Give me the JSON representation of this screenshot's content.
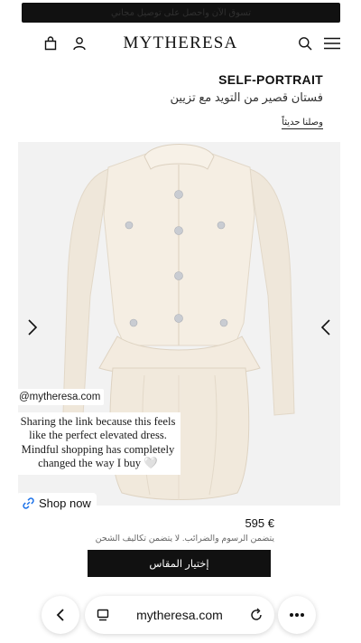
{
  "promo": {
    "text": "تسوق الآن واحصل على توصيل مجاني"
  },
  "header": {
    "logo": "MYTHERESA",
    "icons": [
      "bag-icon",
      "user-icon",
      "search-icon",
      "menu-icon"
    ]
  },
  "product": {
    "brand": "SELF-PORTRAIT",
    "name": "فستان قصير من التويد مع تزيين",
    "badge": "وصلنا حديثاً",
    "price": "595 €",
    "tax_note": "يتضمن الرسوم والضرائب. لا يتضمن تكاليف الشحن",
    "select_size_label": "إختيار المقاس"
  },
  "story": {
    "mention": "@mytheresa.com",
    "caption": "Sharing the link because this feels like the perfect elevated dress. Mindful shopping has completely changed the way I buy 🤍",
    "link_label": "Shop now"
  },
  "browser": {
    "url": "mytheresa.com"
  },
  "colors": {
    "gallery_bg": "#f2f2f2",
    "dress": "#f4ede2",
    "button_bg": "#111111"
  }
}
